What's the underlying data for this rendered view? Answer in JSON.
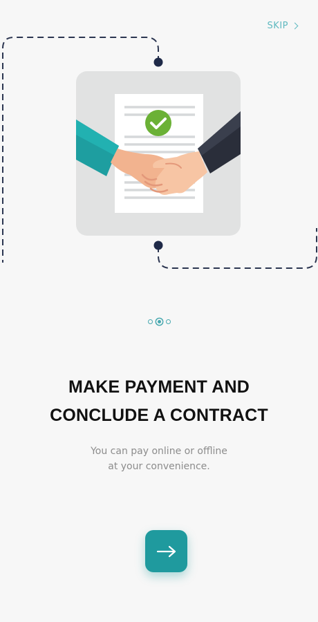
{
  "header": {
    "skip_label": "SKIP",
    "skip_icon": "chevron-right-icon"
  },
  "illustration": {
    "icon": "handshake-contract-icon",
    "check_icon": "checkmark-icon"
  },
  "pagination": {
    "current": 2,
    "total": 3
  },
  "content": {
    "title_line1": "MAKE PAYMENT AND",
    "title_line2": "CONCLUDE A CONTRACT",
    "subtitle_line1": "You can pay online or offline",
    "subtitle_line2": "at your convenience."
  },
  "actions": {
    "next_icon": "arrow-right-icon"
  },
  "colors": {
    "accent": "#1f9a9e",
    "skip": "#5fb9c0",
    "dots": "#47a8af",
    "dashed_line": "#2b3550"
  }
}
